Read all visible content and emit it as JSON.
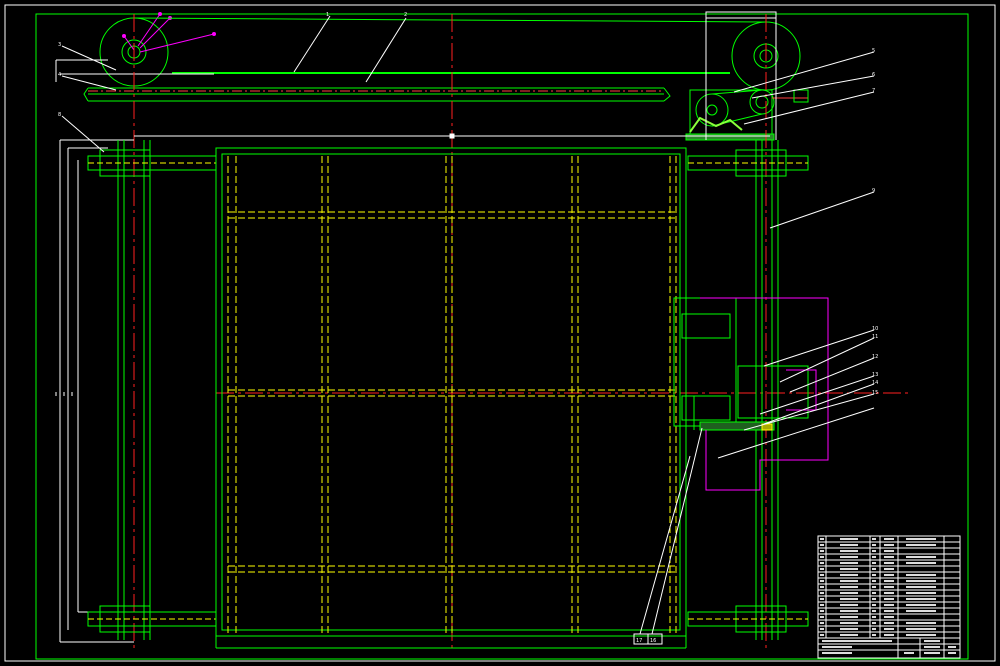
{
  "drawing": {
    "colors": {
      "background": "#000000",
      "outline": "#00ff00",
      "hidden": "#ffff00",
      "center": "#ff0000",
      "dimension": "#ffffff",
      "aux": "#ff00ff",
      "component": "#8cff3c"
    },
    "callouts": [
      "1",
      "2",
      "3",
      "4",
      "5",
      "6",
      "7",
      "8",
      "9",
      "10",
      "11",
      "12",
      "13",
      "14",
      "15",
      "16",
      "17"
    ]
  }
}
